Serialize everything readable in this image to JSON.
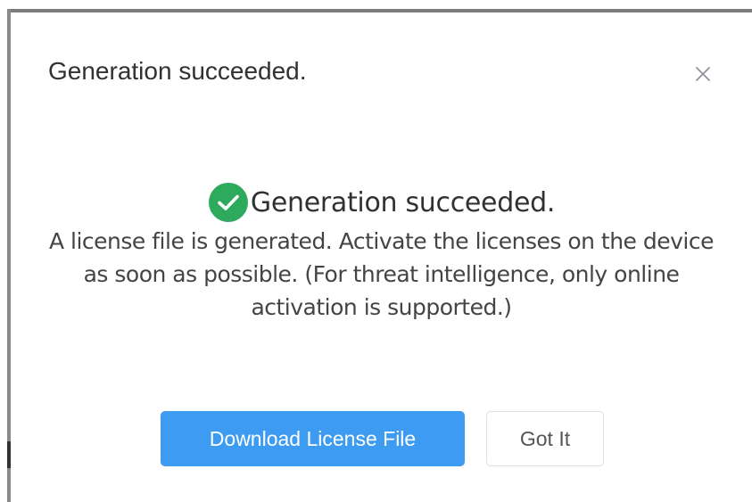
{
  "dialog": {
    "title": "Generation succeeded.",
    "close_icon": "close-icon"
  },
  "result": {
    "status_icon": "check-circle-icon",
    "status_color": "#2eaa5c",
    "heading": "Generation succeeded.",
    "message": "A license file is generated. Activate the licenses on the device as soon as possible. (For threat intelligence, only online activation is supported.)"
  },
  "actions": {
    "download_label": "Download License File",
    "download_color": "#3d9bf2",
    "got_it_label": "Got It"
  }
}
